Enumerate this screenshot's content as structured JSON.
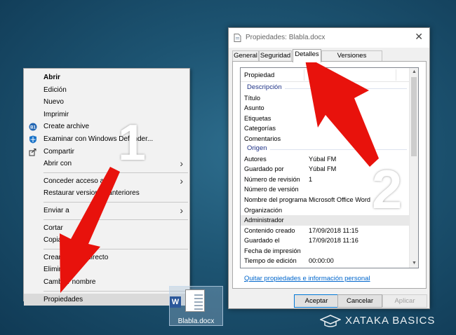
{
  "context_menu": {
    "items": [
      {
        "label": "Abrir",
        "bold": true
      },
      {
        "label": "Edición"
      },
      {
        "label": "Nuevo"
      },
      {
        "label": "Imprimir"
      },
      {
        "label": "Create archive",
        "icon": "b1-archive-icon"
      },
      {
        "label": "Examinar con Windows Defender...",
        "icon": "windows-defender-icon"
      },
      {
        "label": "Compartir",
        "icon": "share-icon"
      },
      {
        "label": "Abrir con",
        "submenu": true
      },
      {
        "label": "Conceder acceso a",
        "submenu": true
      },
      {
        "label": "Restaurar versiones anteriores"
      },
      {
        "label": "Enviar a",
        "submenu": true
      },
      {
        "label": "Cortar"
      },
      {
        "label": "Copiar"
      },
      {
        "label": "Crear acceso directo"
      },
      {
        "label": "Eliminar"
      },
      {
        "label": "Cambiar nombre"
      },
      {
        "label": "Propiedades",
        "highlighted": true
      }
    ]
  },
  "file": {
    "name": "Blabla.docx",
    "badge": "W"
  },
  "dialog": {
    "title": "Propiedades: Blabla.docx",
    "close_glyph": "✕",
    "tabs": [
      {
        "label": "General",
        "active": false
      },
      {
        "label": "Seguridad",
        "active": false
      },
      {
        "label": "Detalles",
        "active": true
      },
      {
        "label": "Versiones anteriores",
        "active": false
      }
    ],
    "grid": {
      "header_property": "Propiedad",
      "sections": [
        {
          "title": "Descripción",
          "rows": [
            {
              "key": "Título",
              "value": ""
            },
            {
              "key": "Asunto",
              "value": ""
            },
            {
              "key": "Etiquetas",
              "value": ""
            },
            {
              "key": "Categorías",
              "value": ""
            },
            {
              "key": "Comentarios",
              "value": ""
            }
          ]
        },
        {
          "title": "Origen",
          "rows": [
            {
              "key": "Autores",
              "value": "Yúbal FM"
            },
            {
              "key": "Guardado por",
              "value": "Yúbal FM"
            },
            {
              "key": "Número de revisión",
              "value": "1"
            },
            {
              "key": "Número de versión",
              "value": ""
            },
            {
              "key": "Nombre del programa",
              "value": "Microsoft Office Word"
            },
            {
              "key": "Organización",
              "value": ""
            },
            {
              "key": "Administrador",
              "value": "",
              "selected": true
            },
            {
              "key": "Contenido creado",
              "value": "17/09/2018 11:15"
            },
            {
              "key": "Guardado el",
              "value": "17/09/2018 11:16"
            },
            {
              "key": "Fecha de impresión",
              "value": ""
            },
            {
              "key": "Tiempo de edición",
              "value": "00:00:00"
            }
          ]
        }
      ]
    },
    "link": "Quitar propiedades e información personal",
    "buttons": {
      "accept": "Aceptar",
      "cancel": "Cancelar",
      "apply": "Aplicar"
    }
  },
  "annotations": {
    "label_1": "1",
    "label_2": "2",
    "arrow_color": "#e8120c"
  },
  "watermark": {
    "text": "XATAKA BASICS"
  },
  "colors": {
    "desktop": "#1d5472",
    "menu_bg": "#f2f2f2",
    "section_title": "#1e3287",
    "link": "#0066cc",
    "word_blue": "#2b579a"
  }
}
